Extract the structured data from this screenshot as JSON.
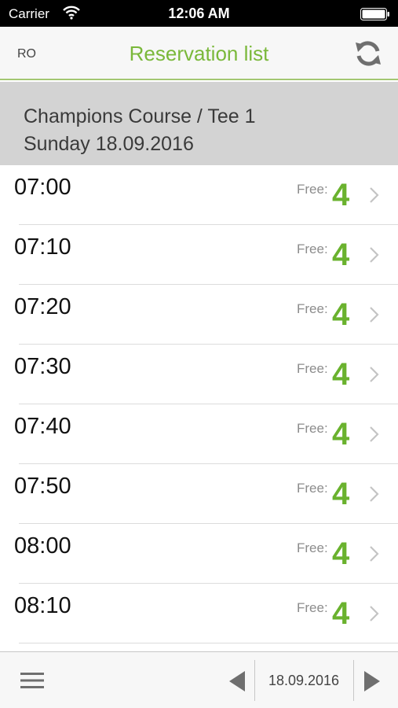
{
  "status_bar": {
    "carrier": "Carrier",
    "time": "12:06 AM"
  },
  "nav": {
    "left_label": "RO",
    "title": "Reservation list",
    "refresh_icon": "refresh-icon"
  },
  "header": {
    "line1": "Champions Course / Tee 1",
    "line2": "Sunday 18.09.2016"
  },
  "slots": [
    {
      "time": "07:00",
      "free_label": "Free:",
      "free": "4"
    },
    {
      "time": "07:10",
      "free_label": "Free:",
      "free": "4"
    },
    {
      "time": "07:20",
      "free_label": "Free:",
      "free": "4"
    },
    {
      "time": "07:30",
      "free_label": "Free:",
      "free": "4"
    },
    {
      "time": "07:40",
      "free_label": "Free:",
      "free": "4"
    },
    {
      "time": "07:50",
      "free_label": "Free:",
      "free": "4"
    },
    {
      "time": "08:00",
      "free_label": "Free:",
      "free": "4"
    },
    {
      "time": "08:10",
      "free_label": "Free:",
      "free": "4"
    }
  ],
  "toolbar": {
    "date": "18.09.2016",
    "menu_icon": "menu-icon",
    "prev_icon": "previous-arrow-icon",
    "next_icon": "next-arrow-icon"
  },
  "colors": {
    "accent_green": "#7ab83a",
    "free_green": "#6ab22e",
    "header_gray": "#d3d3d3"
  }
}
